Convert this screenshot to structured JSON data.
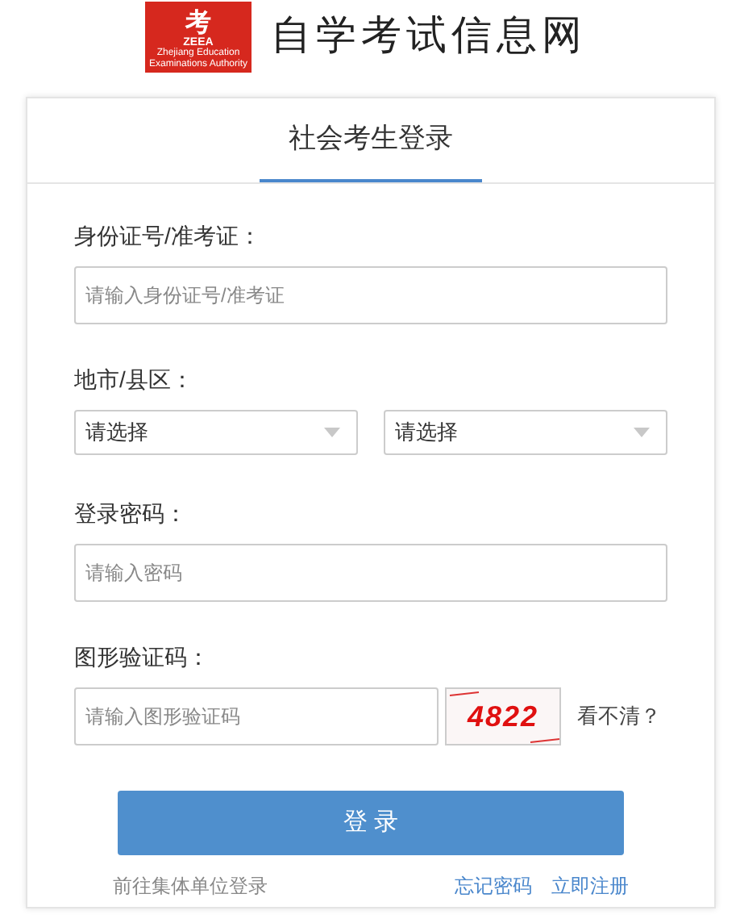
{
  "header": {
    "logo_mark": "考",
    "logo_abbr": "ZEEA",
    "logo_sub": "Zhejiang Education Examinations Authority",
    "site_title": "自学考试信息网"
  },
  "tabs": [
    {
      "label": "社会考生登录",
      "selected": true
    }
  ],
  "fields": [
    {
      "kind": "text",
      "label": "身份证号/准考证：",
      "placeholder": "请输入身份证号/准考证"
    },
    {
      "kind": "select",
      "label": "地市/县区：",
      "selects": [
        "请选择",
        "请选择"
      ]
    },
    {
      "kind": "password",
      "label": "登录密码：",
      "placeholder": "请输入密码"
    },
    {
      "kind": "captcha",
      "label": "图形验证码：",
      "placeholder": "请输入图形验证码",
      "captcha": "4822",
      "refresh": "看不清？"
    }
  ],
  "submit": "登 录",
  "links": {
    "left": "前往集体单位登录",
    "right": [
      "忘记密码",
      "立即注册"
    ]
  }
}
